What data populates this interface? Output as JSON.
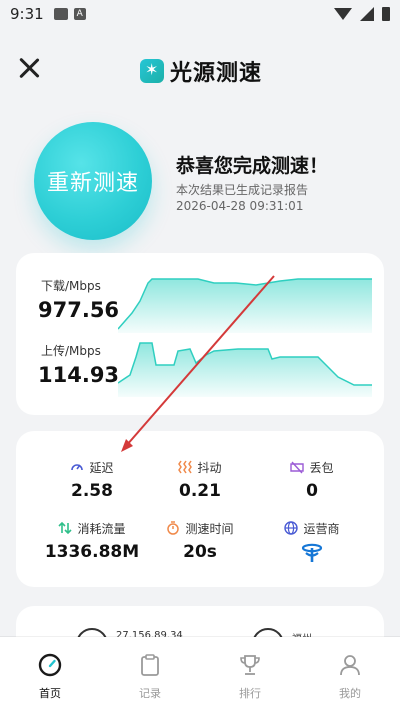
{
  "status_bar": {
    "time": "9:31",
    "icons": [
      "image-icon",
      "text-a-icon",
      "wifi-icon",
      "signal-icon",
      "battery-icon"
    ],
    "a_glyph": "A"
  },
  "header": {
    "app_name": "光源测速",
    "close_icon": "close-icon",
    "logo_icon": "sparkle-logo-icon",
    "accent": "#22c3cf"
  },
  "hero": {
    "retest_label": "重新测速",
    "title": "恭喜您完成测速！",
    "subtitle": "本次结果已生成记录报告",
    "timestamp": "2026-04-28 09:31:01"
  },
  "speed": {
    "download_label": "下载/Mbps",
    "download_value": "977.56",
    "upload_label": "上传/Mbps",
    "upload_value": "114.93",
    "chart_color": "#35d3c4"
  },
  "metrics": [
    {
      "label": "延迟",
      "value": "2.58",
      "icon": "gauge-icon"
    },
    {
      "label": "抖动",
      "value": "0.21",
      "icon": "jitter-icon"
    },
    {
      "label": "丢包",
      "value": "0",
      "icon": "packet-loss-icon"
    },
    {
      "label": "消耗流量",
      "value": "1336.88M",
      "icon": "traffic-icon"
    },
    {
      "label": "测速时间",
      "value": "20s",
      "icon": "timer-icon"
    },
    {
      "label": "运营商",
      "value": "",
      "icon": "globe-icon",
      "value_icon": "china-telecom-logo-icon"
    }
  ],
  "info": {
    "ip": "27.156.89.34",
    "location": "福州"
  },
  "nav": {
    "items": [
      {
        "label": "首页",
        "icon": "speed-gauge-icon",
        "active": true
      },
      {
        "label": "记录",
        "icon": "clipboard-icon",
        "active": false
      },
      {
        "label": "排行",
        "icon": "trophy-icon",
        "active": false
      },
      {
        "label": "我的",
        "icon": "user-icon",
        "active": false
      }
    ]
  },
  "annotation": {
    "color": "#d43a3a"
  }
}
